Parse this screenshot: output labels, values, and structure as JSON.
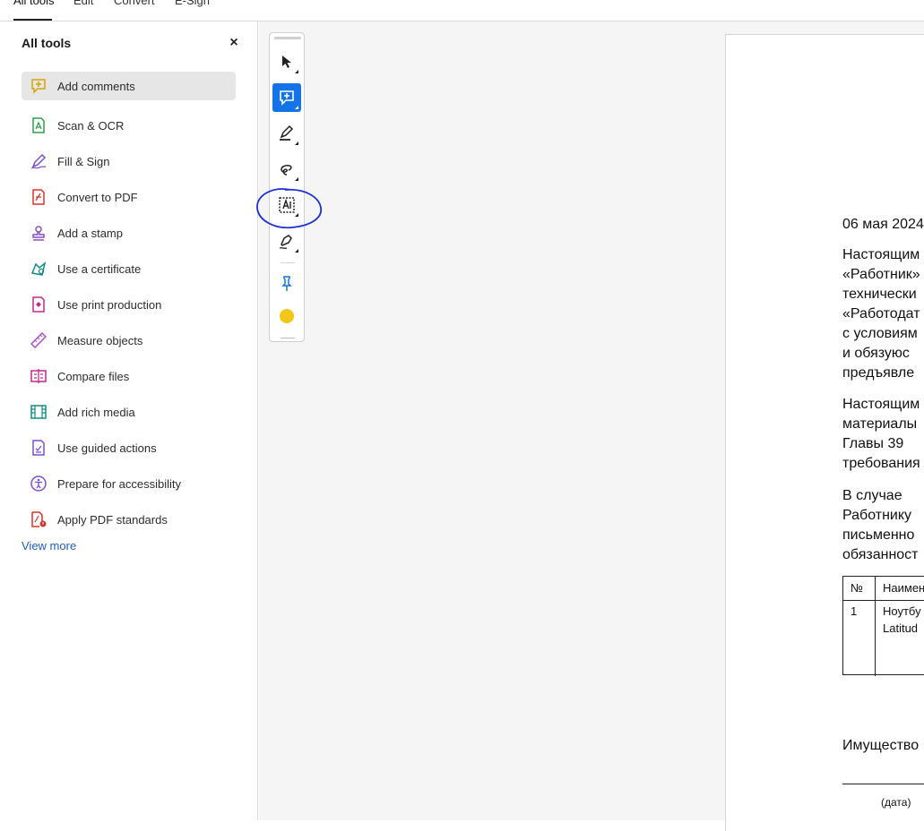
{
  "topbar": {
    "tabs": [
      "All tools",
      "Edit",
      "Convert",
      "E-Sign"
    ]
  },
  "panel": {
    "title": "All tools",
    "close_label": "×",
    "items": [
      {
        "label": "Add comments",
        "icon": "comment-add-icon",
        "color": "#d9a400"
      },
      {
        "label": "Scan & OCR",
        "icon": "scan-ocr-icon",
        "color": "#2e9e4f"
      },
      {
        "label": "Fill & Sign",
        "icon": "fill-sign-icon",
        "color": "#7b4fd1"
      },
      {
        "label": "Convert to PDF",
        "icon": "convert-pdf-icon",
        "color": "#d9342b"
      },
      {
        "label": "Add a stamp",
        "icon": "stamp-icon",
        "color": "#8a4fc9"
      },
      {
        "label": "Use a certificate",
        "icon": "certificate-icon",
        "color": "#138a8a"
      },
      {
        "label": "Use print production",
        "icon": "print-production-icon",
        "color": "#c2298a"
      },
      {
        "label": "Measure objects",
        "icon": "ruler-icon",
        "color": "#b24fc9"
      },
      {
        "label": "Compare files",
        "icon": "compare-icon",
        "color": "#c2298a"
      },
      {
        "label": "Add rich media",
        "icon": "rich-media-icon",
        "color": "#138a8a"
      },
      {
        "label": "Use guided actions",
        "icon": "guided-actions-icon",
        "color": "#7b4fd1"
      },
      {
        "label": "Prepare for accessibility",
        "icon": "accessibility-icon",
        "color": "#7b4fd1"
      },
      {
        "label": "Apply PDF standards",
        "icon": "pdf-standards-icon",
        "color": "#d9342b"
      }
    ],
    "view_more": "View more"
  },
  "toolbar": {
    "tools": [
      {
        "name": "select-tool",
        "icon": "arrow-cursor-icon"
      },
      {
        "name": "comment-tool",
        "icon": "add-comment-icon",
        "active": true
      },
      {
        "name": "highlight-tool",
        "icon": "highlighter-icon"
      },
      {
        "name": "draw-tool",
        "icon": "freehand-draw-icon"
      },
      {
        "name": "text-box-tool",
        "icon": "text-box-icon"
      },
      {
        "name": "pen-tool",
        "icon": "pen-icon"
      },
      {
        "name": "pin-tool",
        "icon": "pin-icon"
      },
      {
        "name": "color-tool",
        "icon": "color-swatch-icon",
        "color": "#f5c518"
      }
    ],
    "annotation_color": "#1a2fd6"
  },
  "document": {
    "date": "06 мая 2024",
    "lines": [
      "Настоящим",
      "«Работник»",
      "технически",
      "«Работодат",
      "с условиям",
      "и  обязуюс",
      "предъявле",
      "Настоящим",
      "материалы",
      "Главы   39",
      "требования",
      "В    случае",
      "Работнику",
      "письменно",
      "обязанност"
    ],
    "table": {
      "header_no": "№",
      "header_name": "Наимен",
      "row_no": "1",
      "row_name_line1": "Ноутбу",
      "row_name_line2": "Latitud"
    },
    "property_line": "Имущество",
    "date_caption": "(дата)"
  }
}
